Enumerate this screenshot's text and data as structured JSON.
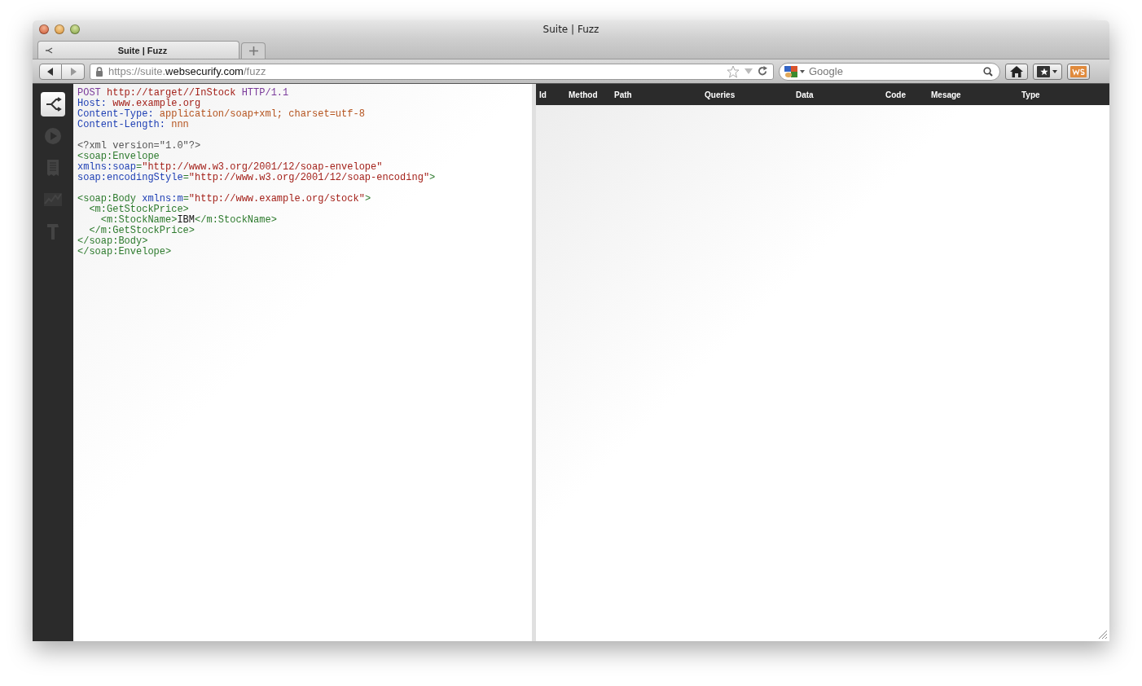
{
  "window": {
    "title": "Suite | Fuzz"
  },
  "tabs": [
    {
      "label": "Suite | Fuzz",
      "selected": true
    }
  ],
  "toolbar": {
    "url": {
      "scheme": "https://suite.",
      "domain": "websecurify.com",
      "path": "/fuzz"
    },
    "search": {
      "placeholder": "Google"
    }
  },
  "sidebar": {
    "items": [
      {
        "kind": "fuzz",
        "selected": true
      },
      {
        "kind": "play",
        "selected": false
      },
      {
        "kind": "report",
        "selected": false
      },
      {
        "kind": "chart",
        "selected": false
      },
      {
        "kind": "hammer",
        "selected": false
      }
    ]
  },
  "editor": {
    "blocks": [
      [
        [
          {
            "kind": "keyword",
            "text": "POST "
          },
          {
            "kind": "string",
            "text": "http://target//InStock "
          },
          {
            "kind": "keyword",
            "text": "HTTP/1.1"
          }
        ],
        [
          {
            "kind": "attr",
            "text": "Host: "
          },
          {
            "kind": "string",
            "text": "www.example.org"
          }
        ],
        [
          {
            "kind": "attr",
            "text": "Content-Type: "
          },
          {
            "kind": "value",
            "text": "application/soap+xml; charset=utf-8"
          }
        ],
        [
          {
            "kind": "attr",
            "text": "Content-Length: "
          },
          {
            "kind": "value",
            "text": "nnn"
          }
        ]
      ],
      [
        [
          {
            "kind": "decl",
            "text": "<?xml version=\"1.0\"?>"
          }
        ],
        [
          {
            "kind": "tag",
            "text": "<soap:Envelope"
          }
        ],
        [
          {
            "kind": "attr",
            "text": "xmlns:soap"
          },
          {
            "kind": "tag",
            "text": "="
          },
          {
            "kind": "string",
            "text": "\"http://www.w3.org/2001/12/soap-envelope\""
          }
        ],
        [
          {
            "kind": "attr",
            "text": "soap:encodingStyle"
          },
          {
            "kind": "tag",
            "text": "="
          },
          {
            "kind": "string",
            "text": "\"http://www.w3.org/2001/12/soap-encoding\""
          },
          {
            "kind": "tag",
            "text": ">"
          }
        ]
      ],
      [
        [
          {
            "kind": "tag",
            "text": "<soap:Body "
          },
          {
            "kind": "attr",
            "text": "xmlns:m"
          },
          {
            "kind": "tag",
            "text": "="
          },
          {
            "kind": "string",
            "text": "\"http://www.example.org/stock\""
          },
          {
            "kind": "tag",
            "text": ">"
          }
        ],
        [
          {
            "kind": "tag",
            "text": "  <m:GetStockPrice>"
          }
        ],
        [
          {
            "kind": "tag",
            "text": "    <m:StockName>"
          },
          {
            "kind": "text",
            "text": "IBM"
          },
          {
            "kind": "tag",
            "text": "</m:StockName>"
          }
        ],
        [
          {
            "kind": "tag",
            "text": "  </m:GetStockPrice>"
          }
        ],
        [
          {
            "kind": "tag",
            "text": "</soap:Body>"
          }
        ],
        [
          {
            "kind": "tag",
            "text": "</soap:Envelope>"
          }
        ]
      ]
    ]
  },
  "table": {
    "columns": [
      "Id",
      "Method",
      "Path",
      "Queries",
      "Data",
      "Code",
      "Mesage",
      "Type"
    ]
  }
}
